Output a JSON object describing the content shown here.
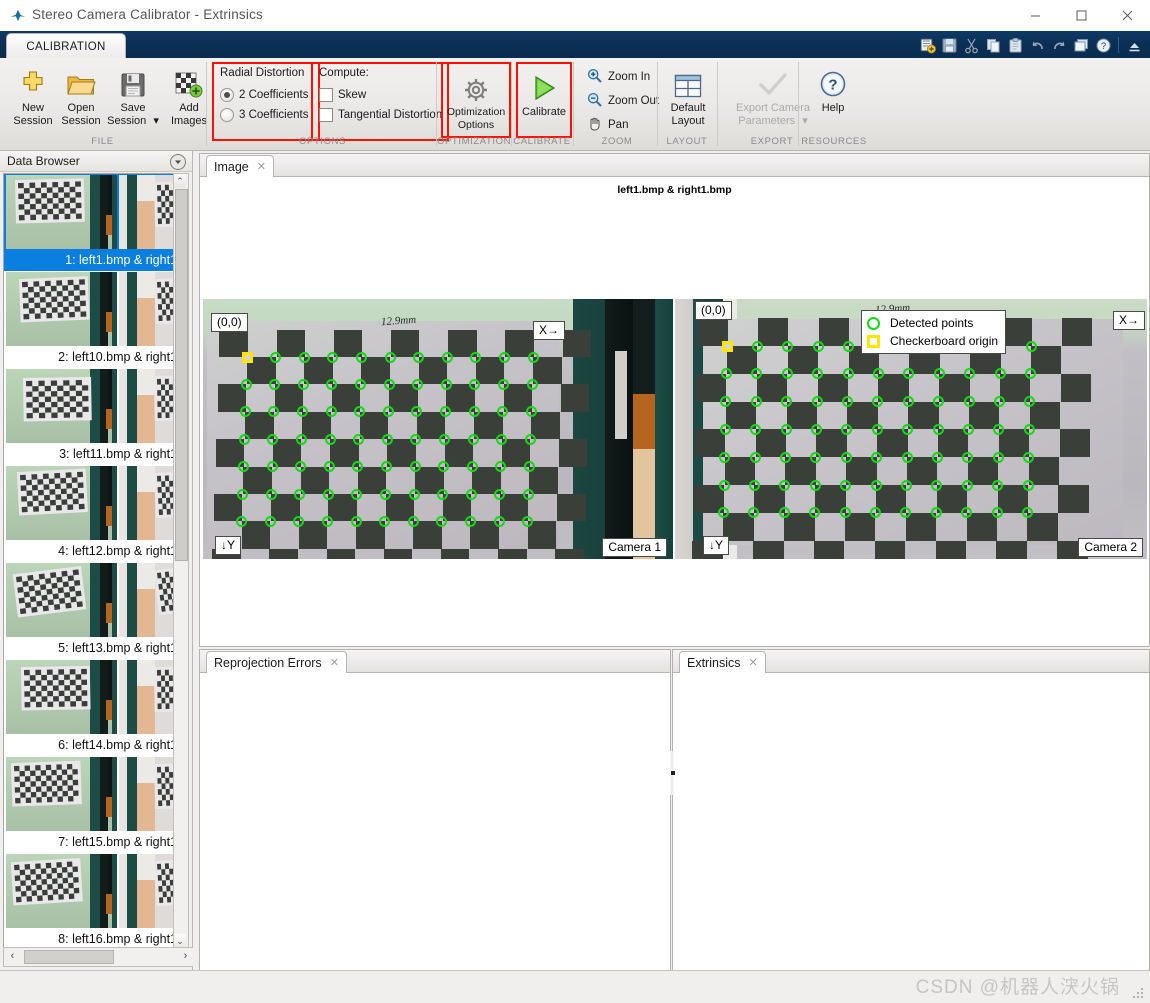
{
  "window": {
    "title": "Stereo Camera Calibrator - Extrinsics",
    "app_icon": "matlab-icon",
    "minimize": "—",
    "maximize": "□",
    "close": "✕"
  },
  "ribbon": {
    "tab": "CALIBRATION",
    "quick_access": [
      {
        "name": "new-session-icon",
        "glyph": "➕"
      },
      {
        "name": "save-icon",
        "glyph": "💾"
      },
      {
        "name": "cut-icon",
        "glyph": "✂"
      },
      {
        "name": "copy-icon",
        "glyph": "⧉"
      },
      {
        "name": "paste-icon",
        "glyph": "📋"
      },
      {
        "name": "undo-icon",
        "glyph": "↶"
      },
      {
        "name": "redo-icon",
        "glyph": "↷"
      },
      {
        "name": "layout-icon",
        "glyph": "❐"
      },
      {
        "name": "help-icon",
        "glyph": "?"
      },
      {
        "name": "collapse-ribbon-icon",
        "glyph": "↑"
      }
    ],
    "groups": {
      "file": {
        "label": "FILE",
        "buttons": [
          {
            "label_line1": "New",
            "label_line2": "Session",
            "icon": "new-session-icon"
          },
          {
            "label_line1": "Open",
            "label_line2": "Session",
            "icon": "open-session-icon"
          },
          {
            "label_line1": "Save",
            "label_line2": "Session",
            "icon": "save-session-icon",
            "has_dropdown": true
          },
          {
            "label_line1": "Add",
            "label_line2": "Images",
            "icon": "add-images-icon"
          }
        ]
      },
      "options": {
        "label": "OPTIONS",
        "radial_distortion": {
          "title": "Radial Distortion",
          "options": [
            {
              "label": "2 Coefficients",
              "selected": true
            },
            {
              "label": "3 Coefficients",
              "selected": false
            }
          ]
        },
        "compute": {
          "title": "Compute:",
          "options": [
            {
              "label": "Skew",
              "checked": false
            },
            {
              "label": "Tangential Distortion",
              "checked": false
            }
          ]
        }
      },
      "optimization": {
        "label": "OPTIMIZATION",
        "button": {
          "label_line1": "Optimization",
          "label_line2": "Options",
          "icon": "gear-icon"
        }
      },
      "calibrate": {
        "label": "CALIBRATE",
        "button": {
          "label_line1": "Calibrate",
          "label_line2": "",
          "icon": "play-triangle-icon"
        }
      },
      "zoom": {
        "label": "ZOOM",
        "items": [
          {
            "label": "Zoom In",
            "icon": "zoom-in-icon"
          },
          {
            "label": "Zoom Out",
            "icon": "zoom-out-icon"
          },
          {
            "label": "Pan",
            "icon": "pan-hand-icon"
          }
        ]
      },
      "layout": {
        "label": "LAYOUT",
        "button": {
          "label_line1": "Default",
          "label_line2": "Layout",
          "icon": "layout-grid-icon"
        }
      },
      "export": {
        "label": "EXPORT",
        "button": {
          "label_line1": "Export Camera",
          "label_line2": "Parameters",
          "icon": "checkmark-icon",
          "disabled": true,
          "has_dropdown": true
        }
      },
      "resources": {
        "label": "RESOURCES",
        "button": {
          "label_line1": "Help",
          "label_line2": "",
          "icon": "help-circle-icon"
        }
      }
    }
  },
  "data_browser": {
    "title": "Data Browser",
    "collapse_icon": "chevron-down-circle-icon",
    "items": [
      {
        "caption": "1: left1.bmp & right1",
        "selected": true
      },
      {
        "caption": "2: left10.bmp & right1",
        "selected": false
      },
      {
        "caption": "3: left11.bmp & right1",
        "selected": false
      },
      {
        "caption": "4: left12.bmp & right1",
        "selected": false
      },
      {
        "caption": "5: left13.bmp & right1",
        "selected": false
      },
      {
        "caption": "6: left14.bmp & right1",
        "selected": false
      },
      {
        "caption": "7: left15.bmp & right1",
        "selected": false
      },
      {
        "caption": "8: left16.bmp & right1",
        "selected": false
      }
    ],
    "scroll_up_icon": "⌃",
    "scroll_down_icon": "⌄",
    "scroll_left_icon": "‹",
    "scroll_right_icon": "›"
  },
  "panels": {
    "image": {
      "tab_label": "Image",
      "close_icon": "✕",
      "plot_title": "left1.bmp & right1.bmp",
      "annotations": {
        "origin_label": "(0,0)",
        "x_axis_label": "X→",
        "y_axis_label": "↓Y",
        "camera1_label": "Camera 1",
        "camera2_label": "Camera 2",
        "handwriting": "12.9mm"
      },
      "legend": {
        "detected_points": "Detected points",
        "checkerboard_origin": "Checkerboard origin",
        "detected_color": "#16d816",
        "origin_color": "#ffe500"
      }
    },
    "reprojection_errors": {
      "tab_label": "Reprojection Errors",
      "close_icon": "✕"
    },
    "extrinsics": {
      "tab_label": "Extrinsics",
      "close_icon": "✕"
    }
  },
  "status": {
    "watermark": "CSDN @机器人涋火锅"
  },
  "chart_data": {
    "type": "scatter",
    "title": "left1.bmp & right1.bmp",
    "description": "Stereo checkerboard corner detection overlay on left1.bmp (Camera 1) and right1.bmp (Camera 2)",
    "series": [
      {
        "name": "Detected points",
        "marker": "circle",
        "color": "#16d816",
        "grid_cols": 11,
        "grid_rows": 7,
        "count": 77
      },
      {
        "name": "Checkerboard origin",
        "marker": "square",
        "color": "#ffe500",
        "count": 1,
        "position": [
          0,
          0
        ]
      }
    ],
    "legend_position": "top-right",
    "grid": false,
    "axes": {
      "x_direction": "X→",
      "y_direction": "↓Y",
      "origin": "(0,0)"
    }
  }
}
